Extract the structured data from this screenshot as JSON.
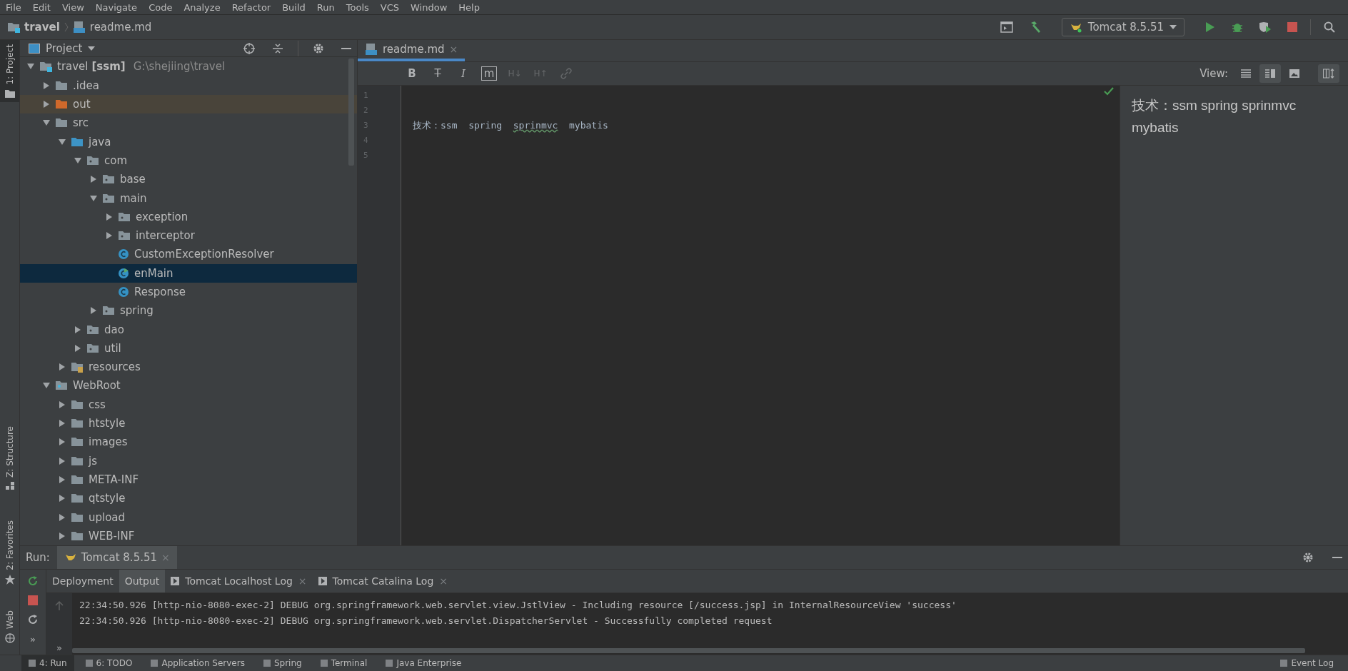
{
  "menu": [
    "File",
    "Edit",
    "View",
    "Navigate",
    "Code",
    "Analyze",
    "Refactor",
    "Build",
    "Run",
    "Tools",
    "VCS",
    "Window",
    "Help"
  ],
  "breadcrumb": [
    {
      "label": "travel",
      "kind": "module"
    },
    {
      "label": "readme.md",
      "kind": "markdown"
    }
  ],
  "toolbar": {
    "run_config": "Tomcat 8.5.51"
  },
  "side_stripe": [
    {
      "label": "1: Project",
      "kind": "project",
      "selected": true
    },
    {
      "label": "Z: Structure",
      "kind": "structure",
      "selected": false
    },
    {
      "label": "2: Favorites",
      "kind": "favorites",
      "selected": false
    },
    {
      "label": "Web",
      "kind": "web",
      "selected": false
    }
  ],
  "project": {
    "title": "Project",
    "tree": [
      {
        "name": "travel",
        "module": "[ssm]",
        "path": "G:\\shejiing\\travel",
        "kind": "module",
        "expanded": true,
        "selected": false,
        "children": [
          {
            "name": ".idea",
            "kind": "folder",
            "expanded": false,
            "selected": false
          },
          {
            "name": "out",
            "kind": "excluded",
            "expanded": false,
            "selected": false
          },
          {
            "name": "src",
            "kind": "folder",
            "expanded": true,
            "selected": false,
            "children": [
              {
                "name": "java",
                "kind": "source",
                "expanded": true,
                "selected": false,
                "children": [
                  {
                    "name": "com",
                    "kind": "package",
                    "expanded": true,
                    "selected": false,
                    "children": [
                      {
                        "name": "base",
                        "kind": "package",
                        "expanded": false,
                        "selected": false
                      },
                      {
                        "name": "main",
                        "kind": "package",
                        "expanded": true,
                        "selected": false,
                        "children": [
                          {
                            "name": "exception",
                            "kind": "package",
                            "expanded": false,
                            "selected": false
                          },
                          {
                            "name": "interceptor",
                            "kind": "package",
                            "expanded": false,
                            "selected": false
                          },
                          {
                            "name": "CustomExceptionResolver",
                            "kind": "class",
                            "runnable": false,
                            "selected": false
                          },
                          {
                            "name": "enMain",
                            "kind": "class",
                            "runnable": true,
                            "selected": true
                          },
                          {
                            "name": "Response",
                            "kind": "class",
                            "runnable": false,
                            "selected": false
                          }
                        ]
                      },
                      {
                        "name": "spring",
                        "kind": "package",
                        "expanded": false,
                        "selected": false
                      }
                    ]
                  },
                  {
                    "name": "dao",
                    "kind": "package",
                    "expanded": false,
                    "selected": false
                  },
                  {
                    "name": "util",
                    "kind": "package",
                    "expanded": false,
                    "selected": false
                  }
                ]
              },
              {
                "name": "resources",
                "kind": "resources",
                "expanded": false,
                "selected": false
              }
            ]
          },
          {
            "name": "WebRoot",
            "kind": "web",
            "expanded": true,
            "selected": false,
            "children": [
              {
                "name": "css",
                "kind": "folder",
                "expanded": false,
                "selected": false
              },
              {
                "name": "htstyle",
                "kind": "folder",
                "expanded": false,
                "selected": false
              },
              {
                "name": "images",
                "kind": "folder",
                "expanded": false,
                "selected": false
              },
              {
                "name": "js",
                "kind": "folder",
                "expanded": false,
                "selected": false
              },
              {
                "name": "META-INF",
                "kind": "folder",
                "expanded": false,
                "selected": false
              },
              {
                "name": "qtstyle",
                "kind": "folder",
                "expanded": false,
                "selected": false
              },
              {
                "name": "upload",
                "kind": "folder",
                "expanded": false,
                "selected": false
              },
              {
                "name": "WEB-INF",
                "kind": "folder",
                "expanded": false,
                "selected": false
              }
            ]
          }
        ]
      }
    ]
  },
  "editor": {
    "tab": {
      "label": "readme.md",
      "close": "×"
    },
    "format_buttons": [
      {
        "label": "B",
        "kind": "bold",
        "disabled": false
      },
      {
        "label": "T",
        "kind": "strike",
        "disabled": false
      },
      {
        "label": "I",
        "kind": "italic",
        "disabled": false
      },
      {
        "label": "m",
        "kind": "code",
        "disabled": false
      },
      {
        "label": "H↓",
        "kind": "heading",
        "disabled": true
      },
      {
        "label": "H↑",
        "kind": "heading",
        "disabled": true
      },
      {
        "kind": "link",
        "disabled": true
      }
    ],
    "view": {
      "label": "View:",
      "modes": [
        {
          "kind": "text",
          "selected": false
        },
        {
          "kind": "split",
          "selected": true
        },
        {
          "kind": "preview",
          "selected": false
        }
      ],
      "sync_scroll": true
    },
    "lines": [
      {
        "number": "1"
      },
      {
        "number": "2"
      },
      {
        "number": "3",
        "segments": [
          {
            "text": "技术：ssm  spring  ",
            "typo": false
          },
          {
            "text": "sprinmvc",
            "typo": true
          },
          {
            "text": "  mybatis",
            "typo": false
          }
        ]
      },
      {
        "number": "4"
      },
      {
        "number": "5"
      }
    ],
    "preview": "技术：ssm spring sprinmvc mybatis"
  },
  "run": {
    "label": "Run:",
    "tab": {
      "label": "Tomcat 8.5.51",
      "close": "×"
    },
    "subtabs": [
      {
        "label": "Deployment",
        "kind": "plain",
        "selected": false
      },
      {
        "label": "Output",
        "kind": "plain",
        "selected": true
      },
      {
        "label": "Tomcat Localhost Log",
        "kind": "log",
        "selected": false,
        "close": "×"
      },
      {
        "label": "Tomcat Catalina Log",
        "kind": "log",
        "selected": false,
        "close": "×"
      }
    ],
    "console": [
      "22:34:50.926 [http-nio-8080-exec-2] DEBUG org.springframework.web.servlet.view.JstlView - Including resource [/success.jsp] in InternalResourceView 'success'",
      "22:34:50.926 [http-nio-8080-exec-2] DEBUG org.springframework.web.servlet.DispatcherServlet - Successfully completed request"
    ],
    "more": "»",
    "gutter_more": "»"
  },
  "bottom_bar": [
    {
      "label": "4: Run",
      "kind": "run",
      "selected": true
    },
    {
      "label": "6: TODO",
      "kind": "todo",
      "selected": false
    },
    {
      "label": "Application Servers",
      "kind": "servers",
      "selected": false
    },
    {
      "label": "Spring",
      "kind": "spring",
      "selected": false
    },
    {
      "label": "Terminal",
      "kind": "terminal",
      "selected": false
    },
    {
      "label": "Java Enterprise",
      "kind": "enterprise",
      "selected": false
    },
    {
      "label": "Event Log",
      "kind": "event",
      "selected": false
    }
  ]
}
